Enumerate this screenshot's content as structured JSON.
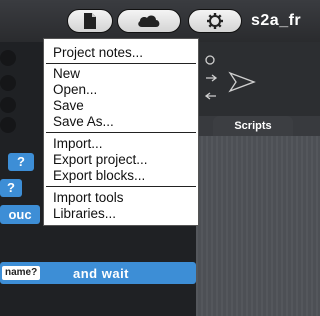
{
  "toolbar": {
    "buttons": [
      {
        "name": "file-button",
        "icon": "file-icon"
      },
      {
        "name": "cloud-button",
        "icon": "cloud-icon"
      },
      {
        "name": "settings-button",
        "icon": "gear-icon"
      }
    ],
    "title": "s2a_fr"
  },
  "file_menu": {
    "items": [
      {
        "label": "Project notes..."
      },
      {
        "label": "New"
      },
      {
        "label": "Open..."
      },
      {
        "label": "Save"
      },
      {
        "label": "Save As..."
      },
      {
        "label": "Import..."
      },
      {
        "label": "Export project..."
      },
      {
        "label": "Export blocks..."
      },
      {
        "label": "Import tools"
      },
      {
        "label": "Libraries..."
      }
    ]
  },
  "palette": {
    "blocks": {
      "q1": "?",
      "q2": "?",
      "touch_fragment": "ouc",
      "ask_slot": "name?",
      "ask_label": "and wait"
    }
  },
  "scripts": {
    "tab_label": "Scripts"
  },
  "colors": {
    "block_sensing": "#3d8ed6",
    "background": "#383a3e",
    "menu_bg": "#ffffff"
  }
}
